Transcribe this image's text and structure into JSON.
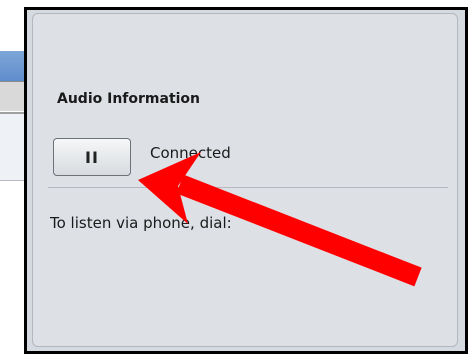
{
  "audio_panel": {
    "title": "Audio Information",
    "pause_button_icon": "pause-icon",
    "pause_button_label": "II",
    "status": "Connected",
    "phone_instructions": "To listen via phone, dial:"
  },
  "annotation": {
    "icon": "arrow-icon",
    "color": "#ff0000"
  },
  "colors": {
    "frame_border": "#000000",
    "panel_background": "#dde1e6"
  }
}
